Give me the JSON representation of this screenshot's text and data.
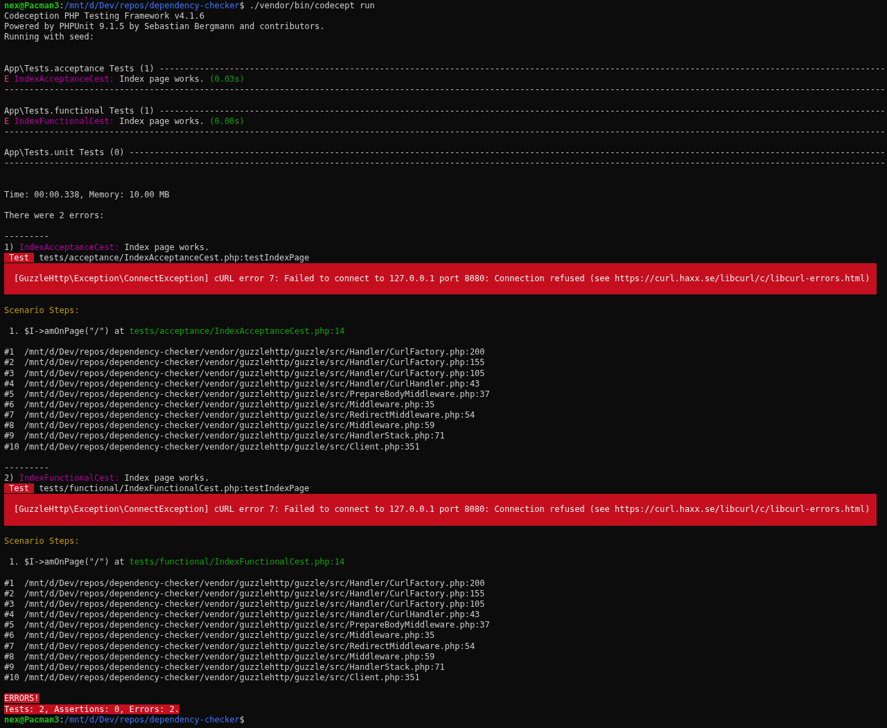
{
  "terminal": {
    "lines": [
      {
        "kind": "text",
        "segments": [
          {
            "kind": "user",
            "text": "nex@Pacman3"
          },
          {
            "kind": "text",
            "text": ":"
          },
          {
            "kind": "path",
            "text": "/mnt/d/Dev/repos/dependency-checker"
          },
          {
            "kind": "text",
            "text": "$ ./vendor/bin/codecept run"
          }
        ]
      },
      {
        "kind": "text",
        "segments": [
          {
            "kind": "text",
            "text": "Codeception PHP Testing Framework v4.1.6"
          }
        ]
      },
      {
        "kind": "text",
        "segments": [
          {
            "kind": "text",
            "text": "Powered by PHPUnit 9.1.5 by Sebastian Bergmann and contributors."
          }
        ]
      },
      {
        "kind": "text",
        "segments": [
          {
            "kind": "text",
            "text": "Running with seed:"
          }
        ]
      },
      {
        "kind": "blank"
      },
      {
        "kind": "blank"
      },
      {
        "kind": "text",
        "segments": [
          {
            "kind": "suite",
            "text": "App\\Tests.acceptance Tests (1) -------------------------------------------------------------------------------------------------------------------------------------------------"
          }
        ]
      },
      {
        "kind": "text",
        "segments": [
          {
            "kind": "mark",
            "text": "E"
          },
          {
            "kind": "test",
            "text": " IndexAcceptanceCest:"
          },
          {
            "kind": "text",
            "text": " Index page works."
          },
          {
            "kind": "timing",
            "text": " (0.03s)"
          }
        ]
      },
      {
        "kind": "text",
        "segments": [
          {
            "kind": "rule",
            "text": "--------------------------------------------------------------------------------------------------------------------------------------------------------------------------------"
          }
        ]
      },
      {
        "kind": "blank"
      },
      {
        "kind": "text",
        "segments": [
          {
            "kind": "suite",
            "text": "App\\Tests.functional Tests (1) -------------------------------------------------------------------------------------------------------------------------------------------------"
          }
        ]
      },
      {
        "kind": "text",
        "segments": [
          {
            "kind": "mark",
            "text": "E"
          },
          {
            "kind": "test",
            "text": " IndexFunctionalCest:"
          },
          {
            "kind": "text",
            "text": " Index page works."
          },
          {
            "kind": "timing",
            "text": " (0.00s)"
          }
        ]
      },
      {
        "kind": "text",
        "segments": [
          {
            "kind": "rule",
            "text": "--------------------------------------------------------------------------------------------------------------------------------------------------------------------------------"
          }
        ]
      },
      {
        "kind": "blank"
      },
      {
        "kind": "text",
        "segments": [
          {
            "kind": "suite",
            "text": "App\\Tests.unit Tests (0) -------------------------------------------------------------------------------------------------------------------------------------------------------"
          }
        ]
      },
      {
        "kind": "text",
        "segments": [
          {
            "kind": "rule",
            "text": "--------------------------------------------------------------------------------------------------------------------------------------------------------------------------------"
          }
        ]
      },
      {
        "kind": "blank"
      },
      {
        "kind": "blank"
      },
      {
        "kind": "text",
        "segments": [
          {
            "kind": "text",
            "text": "Time: 00:00.338, Memory: 10.00 MB"
          }
        ]
      },
      {
        "kind": "blank"
      },
      {
        "kind": "text",
        "segments": [
          {
            "kind": "text",
            "text": "There were 2 errors:"
          }
        ]
      },
      {
        "kind": "blank"
      },
      {
        "kind": "text",
        "segments": [
          {
            "kind": "rule",
            "text": "---------"
          }
        ]
      },
      {
        "kind": "text",
        "segments": [
          {
            "kind": "text",
            "text": "1)"
          },
          {
            "kind": "test",
            "text": " IndexAcceptanceCest:"
          },
          {
            "kind": "text",
            "text": " Index page works."
          }
        ]
      },
      {
        "kind": "text",
        "segments": [
          {
            "kind": "badge",
            "text": "Test"
          },
          {
            "kind": "text",
            "text": " tests/acceptance/IndexAcceptanceCest.php:testIndexPage"
          }
        ]
      },
      {
        "kind": "error_box",
        "text": "[GuzzleHttp\\Exception\\ConnectException] cURL error 7: Failed to connect to 127.0.0.1 port 8080: Connection refused (see https://curl.haxx.se/libcurl/c/libcurl-errors.html)"
      },
      {
        "kind": "blank"
      },
      {
        "kind": "text",
        "segments": [
          {
            "kind": "heading",
            "text": "Scenario Steps:"
          }
        ]
      },
      {
        "kind": "blank"
      },
      {
        "kind": "text",
        "segments": [
          {
            "kind": "text",
            "text": " 1. $I->amOnPage(\"/\") at"
          },
          {
            "kind": "location",
            "text": " tests/acceptance/IndexAcceptanceCest.php:14"
          }
        ]
      },
      {
        "kind": "blank"
      },
      {
        "kind": "text",
        "segments": [
          {
            "kind": "trace",
            "text": "#1  /mnt/d/Dev/repos/dependency-checker/vendor/guzzlehttp/guzzle/src/Handler/CurlFactory.php:200"
          }
        ]
      },
      {
        "kind": "text",
        "segments": [
          {
            "kind": "trace",
            "text": "#2  /mnt/d/Dev/repos/dependency-checker/vendor/guzzlehttp/guzzle/src/Handler/CurlFactory.php:155"
          }
        ]
      },
      {
        "kind": "text",
        "segments": [
          {
            "kind": "trace",
            "text": "#3  /mnt/d/Dev/repos/dependency-checker/vendor/guzzlehttp/guzzle/src/Handler/CurlFactory.php:105"
          }
        ]
      },
      {
        "kind": "text",
        "segments": [
          {
            "kind": "trace",
            "text": "#4  /mnt/d/Dev/repos/dependency-checker/vendor/guzzlehttp/guzzle/src/Handler/CurlHandler.php:43"
          }
        ]
      },
      {
        "kind": "text",
        "segments": [
          {
            "kind": "trace",
            "text": "#5  /mnt/d/Dev/repos/dependency-checker/vendor/guzzlehttp/guzzle/src/PrepareBodyMiddleware.php:37"
          }
        ]
      },
      {
        "kind": "text",
        "segments": [
          {
            "kind": "trace",
            "text": "#6  /mnt/d/Dev/repos/dependency-checker/vendor/guzzlehttp/guzzle/src/Middleware.php:35"
          }
        ]
      },
      {
        "kind": "text",
        "segments": [
          {
            "kind": "trace",
            "text": "#7  /mnt/d/Dev/repos/dependency-checker/vendor/guzzlehttp/guzzle/src/RedirectMiddleware.php:54"
          }
        ]
      },
      {
        "kind": "text",
        "segments": [
          {
            "kind": "trace",
            "text": "#8  /mnt/d/Dev/repos/dependency-checker/vendor/guzzlehttp/guzzle/src/Middleware.php:59"
          }
        ]
      },
      {
        "kind": "text",
        "segments": [
          {
            "kind": "trace",
            "text": "#9  /mnt/d/Dev/repos/dependency-checker/vendor/guzzlehttp/guzzle/src/HandlerStack.php:71"
          }
        ]
      },
      {
        "kind": "text",
        "segments": [
          {
            "kind": "trace",
            "text": "#10 /mnt/d/Dev/repos/dependency-checker/vendor/guzzlehttp/guzzle/src/Client.php:351"
          }
        ]
      },
      {
        "kind": "blank"
      },
      {
        "kind": "text",
        "segments": [
          {
            "kind": "rule",
            "text": "---------"
          }
        ]
      },
      {
        "kind": "text",
        "segments": [
          {
            "kind": "text",
            "text": "2)"
          },
          {
            "kind": "test",
            "text": " IndexFunctionalCest:"
          },
          {
            "kind": "text",
            "text": " Index page works."
          }
        ]
      },
      {
        "kind": "text",
        "segments": [
          {
            "kind": "badge",
            "text": "Test"
          },
          {
            "kind": "text",
            "text": " tests/functional/IndexFunctionalCest.php:testIndexPage"
          }
        ]
      },
      {
        "kind": "error_box",
        "text": "[GuzzleHttp\\Exception\\ConnectException] cURL error 7: Failed to connect to 127.0.0.1 port 8080: Connection refused (see https://curl.haxx.se/libcurl/c/libcurl-errors.html)"
      },
      {
        "kind": "blank"
      },
      {
        "kind": "text",
        "segments": [
          {
            "kind": "heading",
            "text": "Scenario Steps:"
          }
        ]
      },
      {
        "kind": "blank"
      },
      {
        "kind": "text",
        "segments": [
          {
            "kind": "text",
            "text": " 1. $I->amOnPage(\"/\") at"
          },
          {
            "kind": "location",
            "text": " tests/functional/IndexFunctionalCest.php:14"
          }
        ]
      },
      {
        "kind": "blank"
      },
      {
        "kind": "text",
        "segments": [
          {
            "kind": "trace",
            "text": "#1  /mnt/d/Dev/repos/dependency-checker/vendor/guzzlehttp/guzzle/src/Handler/CurlFactory.php:200"
          }
        ]
      },
      {
        "kind": "text",
        "segments": [
          {
            "kind": "trace",
            "text": "#2  /mnt/d/Dev/repos/dependency-checker/vendor/guzzlehttp/guzzle/src/Handler/CurlFactory.php:155"
          }
        ]
      },
      {
        "kind": "text",
        "segments": [
          {
            "kind": "trace",
            "text": "#3  /mnt/d/Dev/repos/dependency-checker/vendor/guzzlehttp/guzzle/src/Handler/CurlFactory.php:105"
          }
        ]
      },
      {
        "kind": "text",
        "segments": [
          {
            "kind": "trace",
            "text": "#4  /mnt/d/Dev/repos/dependency-checker/vendor/guzzlehttp/guzzle/src/Handler/CurlHandler.php:43"
          }
        ]
      },
      {
        "kind": "text",
        "segments": [
          {
            "kind": "trace",
            "text": "#5  /mnt/d/Dev/repos/dependency-checker/vendor/guzzlehttp/guzzle/src/PrepareBodyMiddleware.php:37"
          }
        ]
      },
      {
        "kind": "text",
        "segments": [
          {
            "kind": "trace",
            "text": "#6  /mnt/d/Dev/repos/dependency-checker/vendor/guzzlehttp/guzzle/src/Middleware.php:35"
          }
        ]
      },
      {
        "kind": "text",
        "segments": [
          {
            "kind": "trace",
            "text": "#7  /mnt/d/Dev/repos/dependency-checker/vendor/guzzlehttp/guzzle/src/RedirectMiddleware.php:54"
          }
        ]
      },
      {
        "kind": "text",
        "segments": [
          {
            "kind": "trace",
            "text": "#8  /mnt/d/Dev/repos/dependency-checker/vendor/guzzlehttp/guzzle/src/Middleware.php:59"
          }
        ]
      },
      {
        "kind": "text",
        "segments": [
          {
            "kind": "trace",
            "text": "#9  /mnt/d/Dev/repos/dependency-checker/vendor/guzzlehttp/guzzle/src/HandlerStack.php:71"
          }
        ]
      },
      {
        "kind": "text",
        "segments": [
          {
            "kind": "trace",
            "text": "#10 /mnt/d/Dev/repos/dependency-checker/vendor/guzzlehttp/guzzle/src/Client.php:351"
          }
        ]
      },
      {
        "kind": "blank"
      },
      {
        "kind": "text",
        "segments": [
          {
            "kind": "alert",
            "text": "ERRORS!"
          }
        ]
      },
      {
        "kind": "text",
        "segments": [
          {
            "kind": "alert",
            "text": "Tests: 2, Assertions: 0, Errors: 2."
          }
        ]
      },
      {
        "kind": "text",
        "segments": [
          {
            "kind": "user",
            "text": "nex@Pacman3"
          },
          {
            "kind": "text",
            "text": ":"
          },
          {
            "kind": "path",
            "text": "/mnt/d/Dev/repos/dependency-checker"
          },
          {
            "kind": "text",
            "text": "$"
          }
        ]
      }
    ]
  }
}
